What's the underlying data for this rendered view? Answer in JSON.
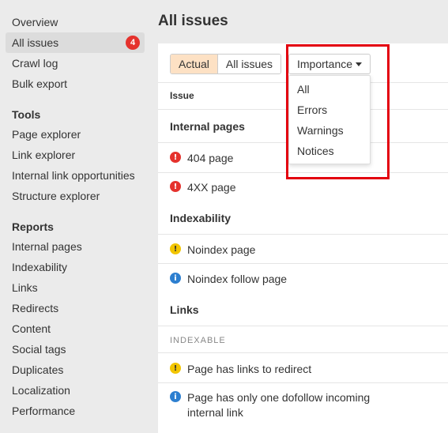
{
  "sidebar": {
    "items": [
      {
        "label": "Overview"
      },
      {
        "label": "All issues",
        "badge": "4"
      },
      {
        "label": "Crawl log"
      },
      {
        "label": "Bulk export"
      }
    ],
    "tools_heading": "Tools",
    "tools": [
      {
        "label": "Page explorer"
      },
      {
        "label": "Link explorer"
      },
      {
        "label": "Internal link opportunities"
      },
      {
        "label": "Structure explorer"
      }
    ],
    "reports_heading": "Reports",
    "reports": [
      {
        "label": "Internal pages"
      },
      {
        "label": "Indexability"
      },
      {
        "label": "Links"
      },
      {
        "label": "Redirects"
      },
      {
        "label": "Content"
      },
      {
        "label": "Social tags"
      },
      {
        "label": "Duplicates"
      },
      {
        "label": "Localization"
      },
      {
        "label": "Performance"
      }
    ]
  },
  "main": {
    "title": "All issues",
    "toggle": {
      "actual": "Actual",
      "all": "All issues"
    },
    "importance_dropdown": {
      "label": "Importance",
      "options": [
        "All",
        "Errors",
        "Warnings",
        "Notices"
      ]
    },
    "column_header": "Issue",
    "groups": [
      {
        "title": "Internal pages",
        "issues": [
          {
            "label": "404 page",
            "severity": "error",
            "icon": "!"
          },
          {
            "label": "4XX page",
            "severity": "error",
            "icon": "!"
          }
        ]
      },
      {
        "title": "Indexability",
        "issues": [
          {
            "label": "Noindex page",
            "severity": "warning",
            "icon": "!"
          },
          {
            "label": "Noindex follow page",
            "severity": "notice",
            "icon": "i"
          }
        ]
      },
      {
        "title": "Links",
        "subtitle": "INDEXABLE",
        "issues": [
          {
            "label": "Page has links to redirect",
            "severity": "warning",
            "icon": "!"
          },
          {
            "label": "Page has only one dofollow incoming internal link",
            "severity": "notice",
            "icon": "i"
          }
        ]
      }
    ]
  },
  "colors": {
    "error": "#e5322d",
    "warning": "#f2c500",
    "notice": "#2d7fd0",
    "active_toggle": "#fde1c4",
    "highlight": "#e3000f"
  }
}
